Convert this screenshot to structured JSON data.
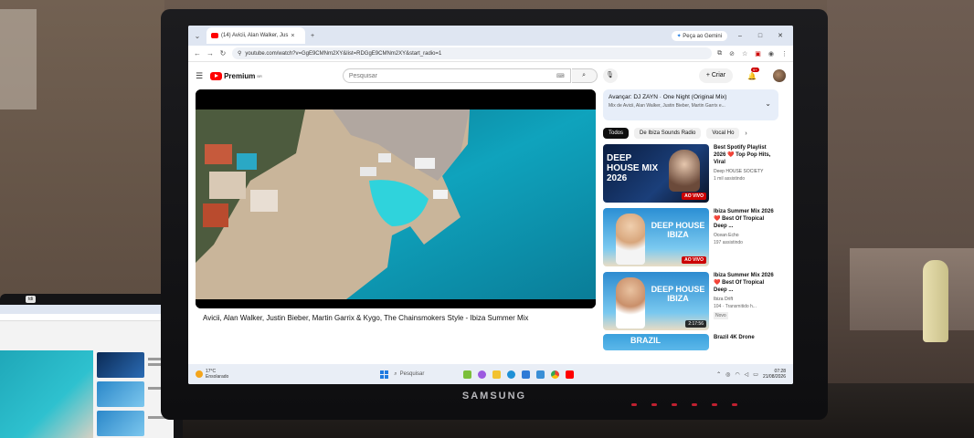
{
  "browser": {
    "tab_title": "(14) Avicii, Alan Walker, Jus",
    "tab_close": "×",
    "new_tab": "+",
    "gemini_label": "Peça ao Gemini",
    "url": "youtube.com/watch?v=GgE9CMNm2XY&list=RDGgE9CMNm2XY&start_radio=1"
  },
  "youtube": {
    "logo_text": "Premium",
    "logo_sup": "BR",
    "search_placeholder": "Pesquisar",
    "create_label": "+ Criar",
    "notification_count": "9+",
    "video_title": "Avicii, Alan Walker, Justin Bieber, Martin Garrix & Kygo, The Chainsmokers Style - Ibiza Summer Mix",
    "up_next": {
      "title": "Avançar: DJ ZAYN · One Night (Original Mix)",
      "subtitle": "Mix de Avicii, Alan Walker, Justin Bieber, Martin Garrix e..."
    },
    "chips": [
      "Todos",
      "De Ibiza Sounds Radio",
      "Vocal Ho"
    ],
    "recommendations": [
      {
        "thumb_text": "DEEP HOUSE MIX 2026",
        "badge": "AO VIVO",
        "title": "Best Spotify Playlist 2026 ❤️ Top Pop Hits, Viral",
        "channel": "Deep HOUSE SOCIETY",
        "meta": "1 mil assistindo"
      },
      {
        "thumb_text": "DEEP HOUSE IBIZA",
        "badge": "AO VIVO",
        "title": "Ibiza Summer Mix 2026 ❤️ Best Of Tropical Deep ...",
        "channel": "Ocean Echo",
        "meta": "197 assistindo"
      },
      {
        "thumb_text": "DEEP HOUSE IBIZA",
        "badge": "2:17:56",
        "title": "Ibiza Summer Mix 2026 ❤️ Best Of Tropical Deep ...",
        "channel": "Ibiza Drift",
        "meta": "104 · Transmitido h..."
      },
      {
        "thumb_text": "BRAZIL",
        "badge": "",
        "title": "Brazil 4K Drone",
        "channel": "",
        "meta": ""
      }
    ],
    "novo_label": "Novo"
  },
  "taskbar": {
    "temperature": "17°C",
    "weather_text": "Ensolarado",
    "search_label": "Pesquisar",
    "time": "07:28",
    "date": "21/08/2026"
  },
  "monitor": {
    "brand": "SAMSUNG"
  },
  "second_monitor": {
    "badge": "tdi"
  },
  "colors": {
    "youtube_red": "#ff0000",
    "live_red": "#cc0000",
    "browser_chrome": "#dfe6f2",
    "water": "#1fa7b8"
  }
}
